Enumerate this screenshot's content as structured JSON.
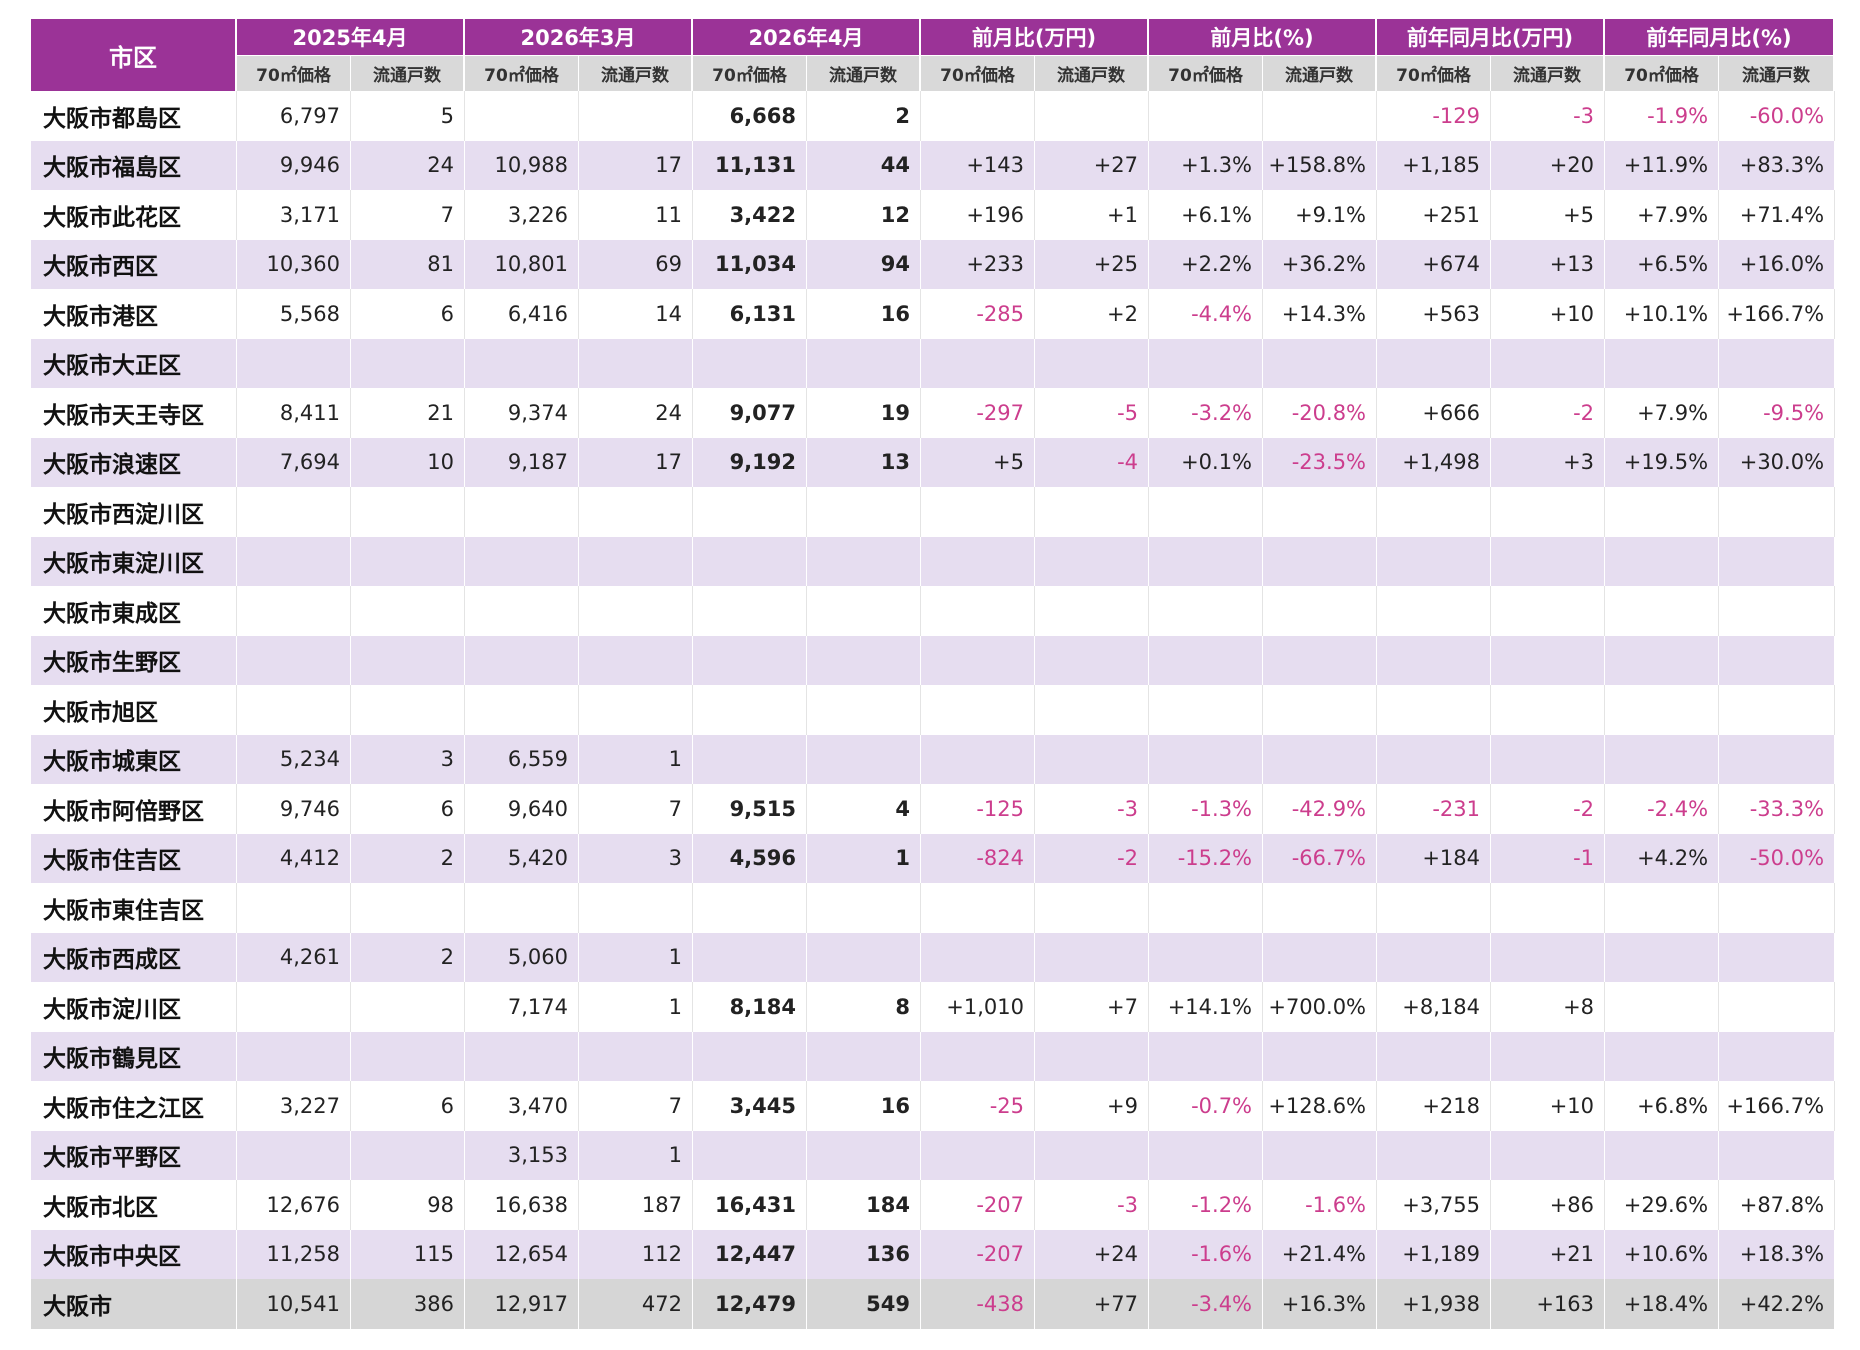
{
  "table": {
    "corner_label": "市区",
    "groups": [
      "2025年4月",
      "2026年3月",
      "2026年4月",
      "前月比(万円)",
      "前月比(%)",
      "前年同月比(万円)",
      "前年同月比(%)"
    ],
    "sub_headers": [
      "70㎡価格",
      "流通戸数"
    ],
    "rows": [
      {
        "name": "大阪市都島区",
        "cells": [
          "6,797",
          "5",
          "",
          "",
          "6,668",
          "2",
          "",
          "",
          "",
          "",
          "-129",
          "-3",
          "-1.9%",
          "-60.0%"
        ]
      },
      {
        "name": "大阪市福島区",
        "cells": [
          "9,946",
          "24",
          "10,988",
          "17",
          "11,131",
          "44",
          "+143",
          "+27",
          "+1.3%",
          "+158.8%",
          "+1,185",
          "+20",
          "+11.9%",
          "+83.3%"
        ]
      },
      {
        "name": "大阪市此花区",
        "cells": [
          "3,171",
          "7",
          "3,226",
          "11",
          "3,422",
          "12",
          "+196",
          "+1",
          "+6.1%",
          "+9.1%",
          "+251",
          "+5",
          "+7.9%",
          "+71.4%"
        ]
      },
      {
        "name": "大阪市西区",
        "cells": [
          "10,360",
          "81",
          "10,801",
          "69",
          "11,034",
          "94",
          "+233",
          "+25",
          "+2.2%",
          "+36.2%",
          "+674",
          "+13",
          "+6.5%",
          "+16.0%"
        ]
      },
      {
        "name": "大阪市港区",
        "cells": [
          "5,568",
          "6",
          "6,416",
          "14",
          "6,131",
          "16",
          "-285",
          "+2",
          "-4.4%",
          "+14.3%",
          "+563",
          "+10",
          "+10.1%",
          "+166.7%"
        ]
      },
      {
        "name": "大阪市大正区",
        "cells": [
          "",
          "",
          "",
          "",
          "",
          "",
          "",
          "",
          "",
          "",
          "",
          "",
          "",
          ""
        ]
      },
      {
        "name": "大阪市天王寺区",
        "cells": [
          "8,411",
          "21",
          "9,374",
          "24",
          "9,077",
          "19",
          "-297",
          "-5",
          "-3.2%",
          "-20.8%",
          "+666",
          "-2",
          "+7.9%",
          "-9.5%"
        ]
      },
      {
        "name": "大阪市浪速区",
        "cells": [
          "7,694",
          "10",
          "9,187",
          "17",
          "9,192",
          "13",
          "+5",
          "-4",
          "+0.1%",
          "-23.5%",
          "+1,498",
          "+3",
          "+19.5%",
          "+30.0%"
        ]
      },
      {
        "name": "大阪市西淀川区",
        "cells": [
          "",
          "",
          "",
          "",
          "",
          "",
          "",
          "",
          "",
          "",
          "",
          "",
          "",
          ""
        ]
      },
      {
        "name": "大阪市東淀川区",
        "cells": [
          "",
          "",
          "",
          "",
          "",
          "",
          "",
          "",
          "",
          "",
          "",
          "",
          "",
          ""
        ]
      },
      {
        "name": "大阪市東成区",
        "cells": [
          "",
          "",
          "",
          "",
          "",
          "",
          "",
          "",
          "",
          "",
          "",
          "",
          "",
          ""
        ]
      },
      {
        "name": "大阪市生野区",
        "cells": [
          "",
          "",
          "",
          "",
          "",
          "",
          "",
          "",
          "",
          "",
          "",
          "",
          "",
          ""
        ]
      },
      {
        "name": "大阪市旭区",
        "cells": [
          "",
          "",
          "",
          "",
          "",
          "",
          "",
          "",
          "",
          "",
          "",
          "",
          "",
          ""
        ]
      },
      {
        "name": "大阪市城東区",
        "cells": [
          "5,234",
          "3",
          "6,559",
          "1",
          "",
          "",
          "",
          "",
          "",
          "",
          "",
          "",
          "",
          ""
        ]
      },
      {
        "name": "大阪市阿倍野区",
        "cells": [
          "9,746",
          "6",
          "9,640",
          "7",
          "9,515",
          "4",
          "-125",
          "-3",
          "-1.3%",
          "-42.9%",
          "-231",
          "-2",
          "-2.4%",
          "-33.3%"
        ]
      },
      {
        "name": "大阪市住吉区",
        "cells": [
          "4,412",
          "2",
          "5,420",
          "3",
          "4,596",
          "1",
          "-824",
          "-2",
          "-15.2%",
          "-66.7%",
          "+184",
          "-1",
          "+4.2%",
          "-50.0%"
        ]
      },
      {
        "name": "大阪市東住吉区",
        "cells": [
          "",
          "",
          "",
          "",
          "",
          "",
          "",
          "",
          "",
          "",
          "",
          "",
          "",
          ""
        ]
      },
      {
        "name": "大阪市西成区",
        "cells": [
          "4,261",
          "2",
          "5,060",
          "1",
          "",
          "",
          "",
          "",
          "",
          "",
          "",
          "",
          "",
          ""
        ]
      },
      {
        "name": "大阪市淀川区",
        "cells": [
          "",
          "",
          "7,174",
          "1",
          "8,184",
          "8",
          "+1,010",
          "+7",
          "+14.1%",
          "+700.0%",
          "+8,184",
          "+8",
          "",
          ""
        ]
      },
      {
        "name": "大阪市鶴見区",
        "cells": [
          "",
          "",
          "",
          "",
          "",
          "",
          "",
          "",
          "",
          "",
          "",
          "",
          "",
          ""
        ]
      },
      {
        "name": "大阪市住之江区",
        "cells": [
          "3,227",
          "6",
          "3,470",
          "7",
          "3,445",
          "16",
          "-25",
          "+9",
          "-0.7%",
          "+128.6%",
          "+218",
          "+10",
          "+6.8%",
          "+166.7%"
        ]
      },
      {
        "name": "大阪市平野区",
        "cells": [
          "",
          "",
          "3,153",
          "1",
          "",
          "",
          "",
          "",
          "",
          "",
          "",
          "",
          "",
          ""
        ]
      },
      {
        "name": "大阪市北区",
        "cells": [
          "12,676",
          "98",
          "16,638",
          "187",
          "16,431",
          "184",
          "-207",
          "-3",
          "-1.2%",
          "-1.6%",
          "+3,755",
          "+86",
          "+29.6%",
          "+87.8%"
        ]
      },
      {
        "name": "大阪市中央区",
        "cells": [
          "11,258",
          "115",
          "12,654",
          "112",
          "12,447",
          "136",
          "-207",
          "+24",
          "-1.6%",
          "+21.4%",
          "+1,189",
          "+21",
          "+10.6%",
          "+18.3%"
        ]
      },
      {
        "name": "大阪市",
        "cells": [
          "10,541",
          "386",
          "12,917",
          "472",
          "12,479",
          "549",
          "-438",
          "+77",
          "-3.4%",
          "+16.3%",
          "+1,938",
          "+163",
          "+18.4%",
          "+42.2%"
        ]
      }
    ]
  },
  "colors": {
    "header_purple": "#9b3397",
    "subheader_gray": "#d9d9d9",
    "row_lavender": "#e6ddf0",
    "total_gray": "#d6d6d6",
    "negative_pink": "#cc3d8d"
  }
}
